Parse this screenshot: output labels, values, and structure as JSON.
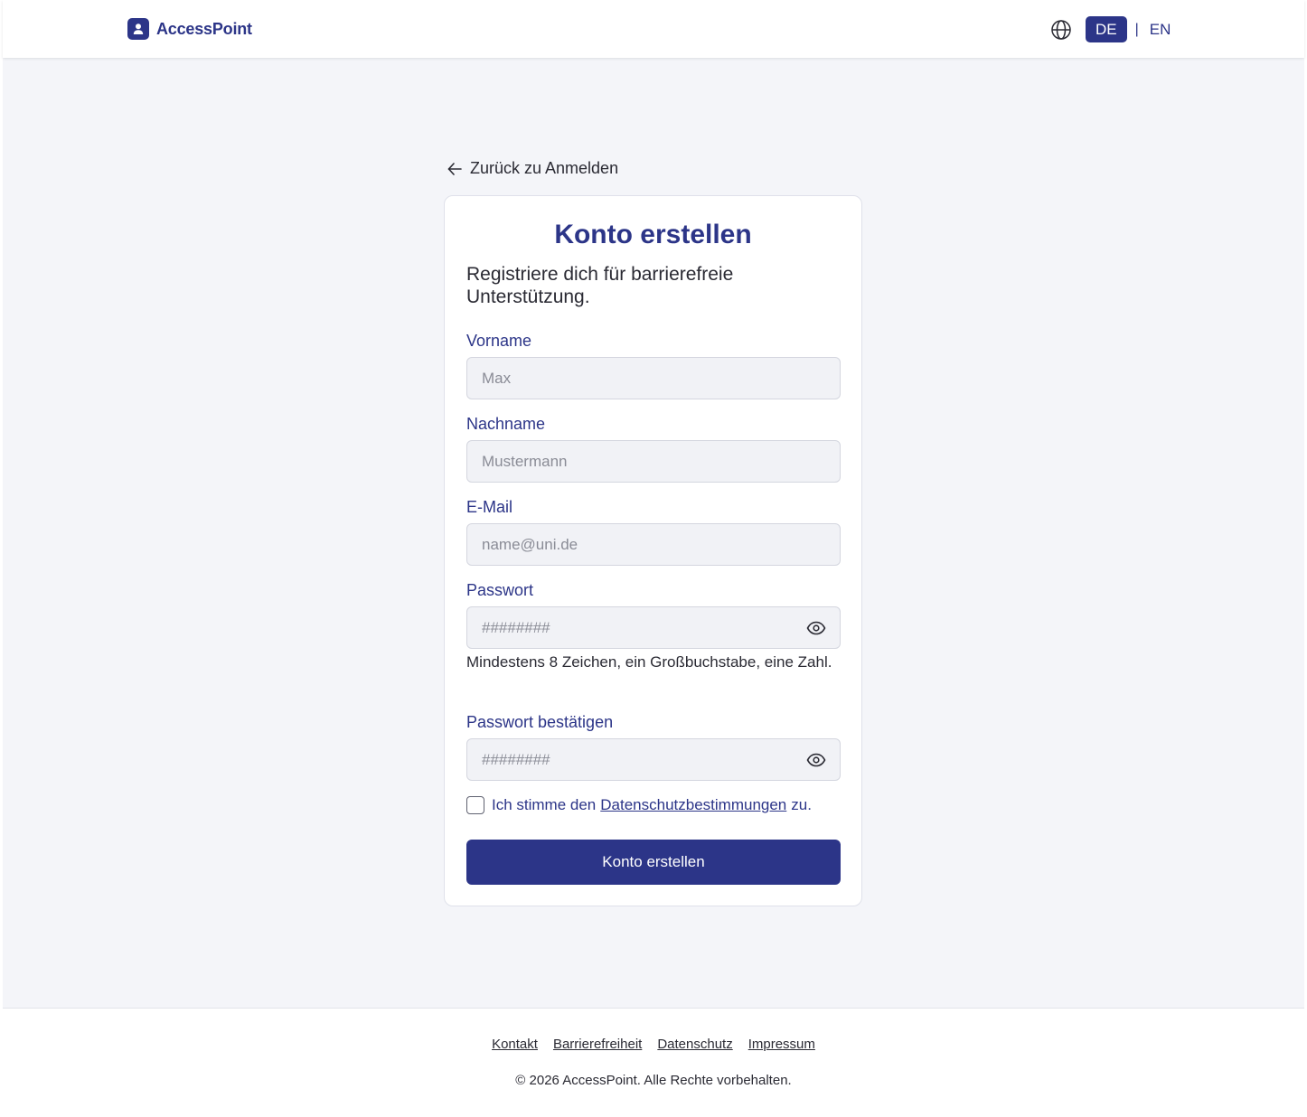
{
  "brand": {
    "name": "AccessPoint",
    "logo_icon": "user-badge-icon"
  },
  "language": {
    "icon": "globe-icon",
    "options": [
      "DE",
      "EN"
    ],
    "active": "DE",
    "separator": "|"
  },
  "back_link": {
    "label": "Zurück zu Anmelden",
    "icon": "arrow-left-icon"
  },
  "form": {
    "title": "Konto erstellen",
    "subtitle": "Registriere dich für barrierefreie Unterstützung.",
    "fields": [
      {
        "label": "Vorname",
        "placeholder": "Max",
        "value": ""
      },
      {
        "label": "Nachname",
        "placeholder": "Mustermann",
        "value": ""
      },
      {
        "label": "E-Mail",
        "placeholder": "name@uni.de",
        "value": ""
      },
      {
        "label": "Passwort",
        "placeholder": "########",
        "value": "",
        "toggle_icon": "eye-icon"
      },
      {
        "label": "Passwort bestätigen",
        "placeholder": "########",
        "value": "",
        "toggle_icon": "eye-icon"
      }
    ],
    "password_hint": "Mindestens 8 Zeichen, ein Großbuchstabe, eine Zahl.",
    "consent": {
      "checked": false,
      "text_before": "Ich stimme den",
      "link_text": "Datenschutzbestimmungen",
      "text_after": "zu."
    },
    "submit_label": "Konto erstellen"
  },
  "footer": {
    "links": [
      "Kontakt",
      "Barrierefreiheit",
      "Datenschutz",
      "Impressum"
    ],
    "copyright": "© 2026 AccessPoint. Alle Rechte vorbehalten."
  },
  "colors": {
    "primary": "#2c3588",
    "background": "#f4f5f9",
    "input_background": "#f1f2f6",
    "text": "#2a2a33"
  }
}
